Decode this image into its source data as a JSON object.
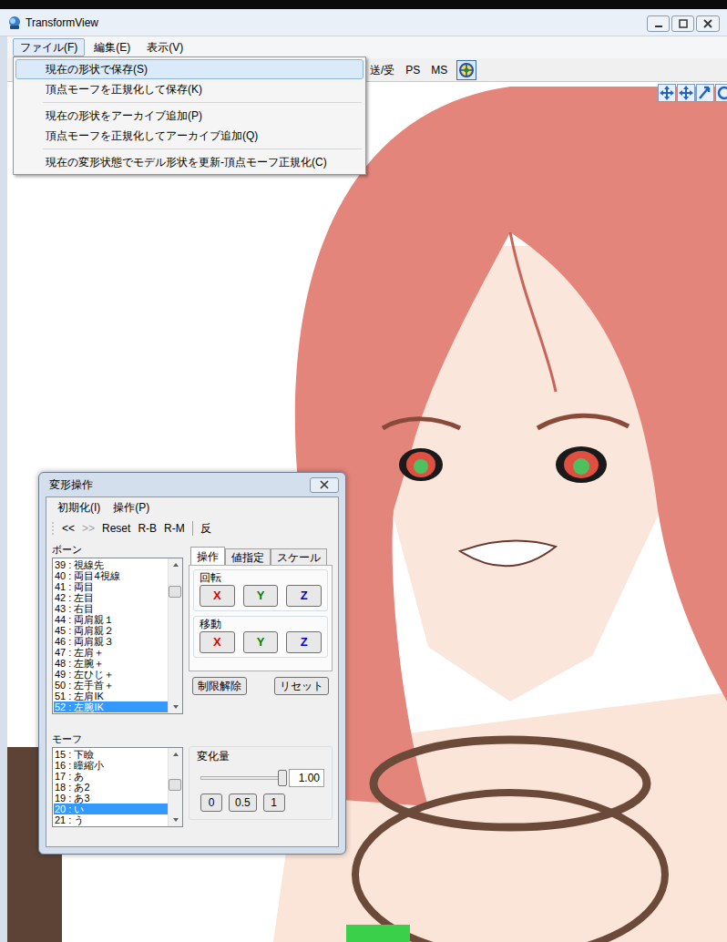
{
  "window": {
    "title": "TransformView"
  },
  "menu_bar": [
    {
      "label": "ファイル(F)",
      "selected": true
    },
    {
      "label": "編集(E)",
      "selected": false
    },
    {
      "label": "表示(V)",
      "selected": false
    }
  ],
  "toolbar": [
    "送/受",
    "PS",
    "MS"
  ],
  "file_menu": [
    {
      "kind": "item",
      "label": "現在の形状で保存(S)",
      "selected": true
    },
    {
      "kind": "item",
      "label": "頂点モーフを正規化して保存(K)",
      "selected": false
    },
    {
      "kind": "separator"
    },
    {
      "kind": "item",
      "label": "現在の形状をアーカイブ追加(P)",
      "selected": false
    },
    {
      "kind": "item",
      "label": "頂点モーフを正規化してアーカイブ追加(Q)",
      "selected": false
    },
    {
      "kind": "separator"
    },
    {
      "kind": "item",
      "label": "現在の変形状態でモデル形状を更新-頂点モーフ正規化(C)",
      "selected": false
    }
  ],
  "transform_panel": {
    "title": "変形操作",
    "menu": [
      "初期化(I)",
      "操作(P)"
    ],
    "toolbar": [
      {
        "kind": "button",
        "label": "<<",
        "disabled": false
      },
      {
        "kind": "button",
        "label": ">>",
        "disabled": true
      },
      {
        "kind": "button",
        "label": "Reset",
        "disabled": false
      },
      {
        "kind": "button",
        "label": "R-B",
        "disabled": false
      },
      {
        "kind": "button",
        "label": "R-M",
        "disabled": false
      },
      {
        "kind": "separator"
      },
      {
        "kind": "button",
        "label": "反",
        "disabled": false
      }
    ],
    "bones": {
      "label": "ボーン",
      "items": [
        {
          "label": "39 : 視線先",
          "selected": false
        },
        {
          "label": "40 : 両目4視線",
          "selected": false
        },
        {
          "label": "41 : 両目",
          "selected": false
        },
        {
          "label": "42 : 左目",
          "selected": false
        },
        {
          "label": "43 : 右目",
          "selected": false
        },
        {
          "label": "44 : 両肩親１",
          "selected": false
        },
        {
          "label": "45 : 両肩親２",
          "selected": false
        },
        {
          "label": "46 : 両肩親３",
          "selected": false
        },
        {
          "label": "47 : 左肩＋",
          "selected": false
        },
        {
          "label": "48 : 左腕＋",
          "selected": false
        },
        {
          "label": "49 : 左ひじ＋",
          "selected": false
        },
        {
          "label": "50 : 左手首＋",
          "selected": false
        },
        {
          "label": "51 : 左肩IK",
          "selected": false
        },
        {
          "label": "52 : 左腕IK",
          "selected": true
        }
      ]
    },
    "tabs": [
      {
        "label": "操作",
        "selected": true
      },
      {
        "label": "値指定",
        "selected": false
      },
      {
        "label": "スケール",
        "selected": false
      }
    ],
    "groups": [
      {
        "label": "回転",
        "buttons": [
          {
            "label": "X",
            "color": "#e00000"
          },
          {
            "label": "Y",
            "color": "#008000"
          },
          {
            "label": "Z",
            "color": "#0000d0"
          }
        ]
      },
      {
        "label": "移動",
        "buttons": [
          {
            "label": "X",
            "color": "#e00000"
          },
          {
            "label": "Y",
            "color": "#008000"
          },
          {
            "label": "Z",
            "color": "#0000d0"
          }
        ]
      }
    ],
    "actions": [
      "制限解除",
      "リセット"
    ],
    "morphs": {
      "label": "モーフ",
      "items": [
        {
          "label": "15 : 下瞼",
          "selected": false
        },
        {
          "label": "16 : 瞳縮小",
          "selected": false
        },
        {
          "label": "17 : あ",
          "selected": false
        },
        {
          "label": "18 : あ2",
          "selected": false
        },
        {
          "label": "19 : あ3",
          "selected": false
        },
        {
          "label": "20 : い",
          "selected": true
        },
        {
          "label": "21 : う",
          "selected": false
        }
      ]
    },
    "amount": {
      "label": "変化量",
      "level": 1,
      "value": "1.00",
      "presets": [
        "0",
        "0.5",
        "1"
      ]
    }
  }
}
